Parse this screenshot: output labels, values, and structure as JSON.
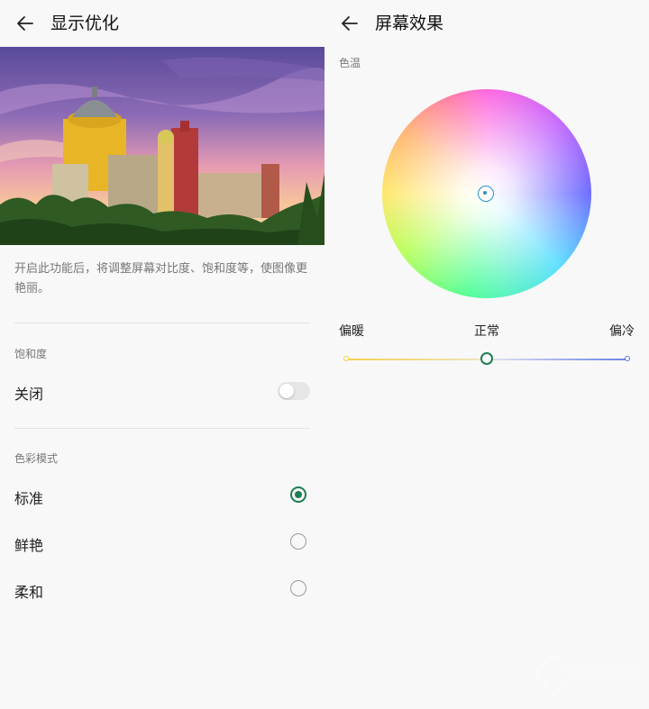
{
  "left_screen": {
    "header": {
      "title": "显示优化",
      "back_icon": "arrow-left-icon"
    },
    "description": "开启此功能后，将调整屏幕对比度、饱和度等，使图像更艳丽。",
    "saturation": {
      "section_label": "饱和度",
      "option_label": "关闭",
      "toggle_on": false
    },
    "color_mode": {
      "section_label": "色彩模式",
      "options": [
        {
          "label": "标准",
          "selected": true
        },
        {
          "label": "鲜艳",
          "selected": false
        },
        {
          "label": "柔和",
          "selected": false
        }
      ]
    },
    "accent_color": "#1e7d51"
  },
  "right_screen": {
    "header": {
      "title": "屏幕效果",
      "back_icon": "arrow-left-icon"
    },
    "color_temp_label": "色温",
    "slider": {
      "label_warm": "偏暖",
      "label_normal": "正常",
      "label_cool": "偏冷",
      "value": 0.5
    },
    "colors": {
      "warm": "#f2d050",
      "cool": "#6c82e8",
      "picker": "#2a90d0"
    }
  }
}
